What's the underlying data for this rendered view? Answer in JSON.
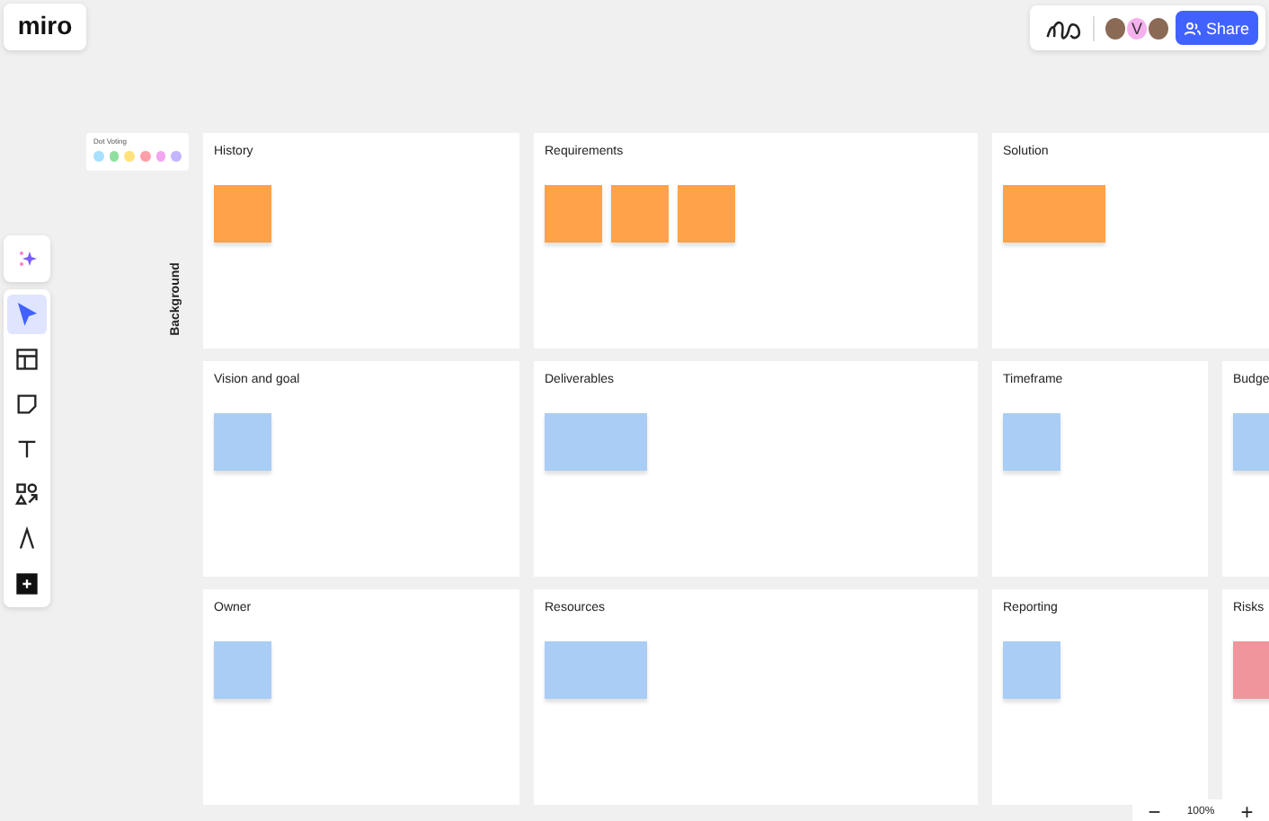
{
  "logo": "miro",
  "collaborators": {
    "avatars": [
      {
        "kind": "photo"
      },
      {
        "kind": "letter",
        "letter": "V",
        "color": "#f5b0ee"
      },
      {
        "kind": "photo"
      }
    ],
    "share_button": "Share"
  },
  "toolbar": {
    "tools": [
      {
        "kind": "select",
        "selected": true
      },
      {
        "kind": "templates",
        "selected": false
      },
      {
        "kind": "sticky",
        "selected": false
      },
      {
        "kind": "text",
        "selected": false
      },
      {
        "kind": "shapes",
        "selected": false
      },
      {
        "kind": "pen",
        "selected": false
      },
      {
        "kind": "more",
        "selected": false
      }
    ]
  },
  "dot_voting": {
    "title": "Dot Voting",
    "dots": [
      {
        "color": "#a8e0ff"
      },
      {
        "color": "#8fe0a0"
      },
      {
        "color": "#ffe27a"
      },
      {
        "color": "#ff9fa8"
      },
      {
        "color": "#f2a6f0"
      },
      {
        "color": "#c3b5ff"
      }
    ]
  },
  "side_label": "Background",
  "frames": [
    {
      "title": "History",
      "wide": false,
      "stickies": [
        {
          "color": "#ffa24a",
          "kind": "square"
        }
      ]
    },
    {
      "title": "Requirements",
      "wide": false,
      "stickies": [
        {
          "color": "#ffa24a",
          "kind": "square"
        },
        {
          "color": "#ffa24a",
          "kind": "square"
        },
        {
          "color": "#ffa24a",
          "kind": "square"
        }
      ]
    },
    {
      "title": "Solution",
      "wide": true,
      "stickies": [
        {
          "color": "#ffa24a",
          "kind": "wide"
        }
      ]
    },
    {
      "title": "Vision and goal",
      "wide": false,
      "stickies": [
        {
          "color": "#a9cdf5",
          "kind": "square"
        }
      ]
    },
    {
      "title": "Deliverables",
      "wide": false,
      "stickies": [
        {
          "color": "#a9cdf5",
          "kind": "wide"
        }
      ]
    },
    {
      "title": "Timeframe",
      "wide": false,
      "stickies": [
        {
          "color": "#a9cdf5",
          "kind": "square"
        }
      ]
    },
    {
      "title": "Budge",
      "wide": false,
      "stickies": [
        {
          "color": "#a9cdf5",
          "kind": "square"
        }
      ]
    },
    {
      "title": "Owner",
      "wide": false,
      "stickies": [
        {
          "color": "#a9cdf5",
          "kind": "square"
        }
      ]
    },
    {
      "title": "Resources",
      "wide": false,
      "stickies": [
        {
          "color": "#a9cdf5",
          "kind": "wide"
        }
      ]
    },
    {
      "title": "Reporting",
      "wide": false,
      "stickies": [
        {
          "color": "#a9cdf5",
          "kind": "square"
        }
      ]
    },
    {
      "title": "Risks",
      "wide": false,
      "stickies": [
        {
          "color": "#f0959b",
          "kind": "square"
        }
      ]
    }
  ],
  "zoom": {
    "minus": "−",
    "level": "100%",
    "plus": "+"
  }
}
